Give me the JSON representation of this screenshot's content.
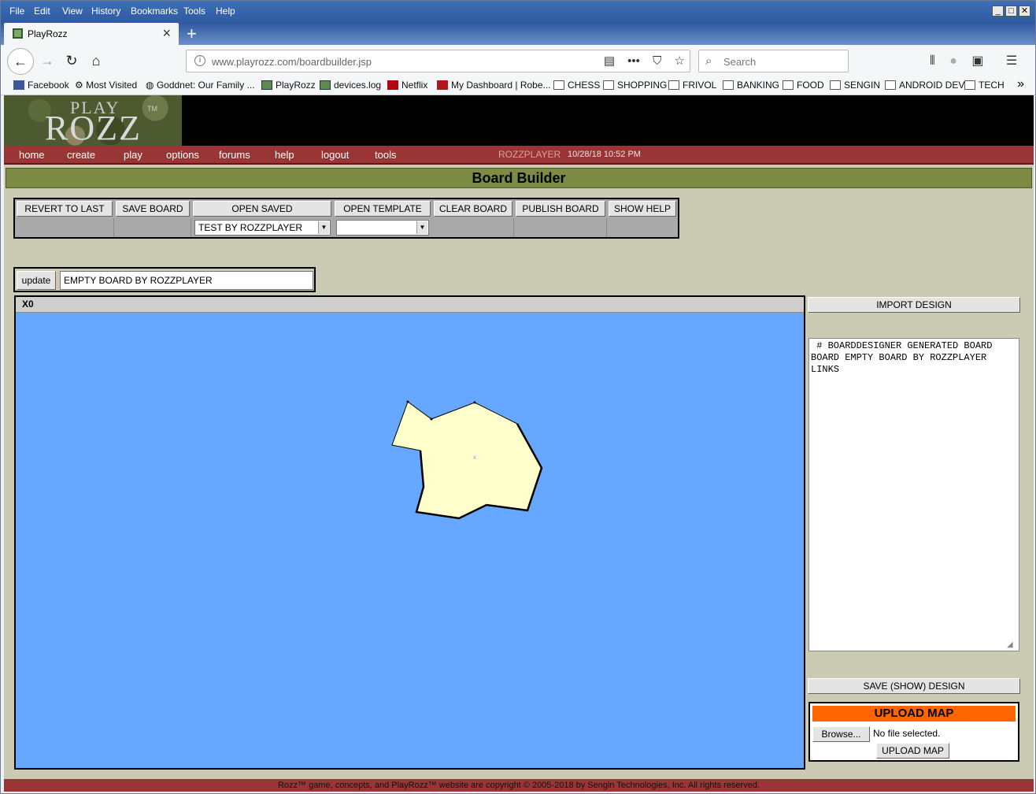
{
  "browser": {
    "menu": [
      "File",
      "Edit",
      "View",
      "History",
      "Bookmarks",
      "Tools",
      "Help"
    ],
    "tab_title": "PlayRozz",
    "url_host": "www.playrozz.com",
    "url_path": "/boardbuilder.jsp",
    "search_placeholder": "Search",
    "bookmarks": [
      "Facebook",
      "Most Visited",
      "Goddnet: Our Family ...",
      "PlayRozz",
      "devices.log",
      "Netflix",
      "My Dashboard | Robe...",
      "CHESS",
      "SHOPPING",
      "FRIVOL",
      "BANKING",
      "FOOD",
      "SENGIN",
      "ANDROID DEV",
      "TECH"
    ]
  },
  "site": {
    "logo_play": "PLAY",
    "logo_rozz": "ROZZ",
    "logo_tm": "TM",
    "nav": [
      "home",
      "create",
      "play",
      "options",
      "forums",
      "help",
      "logout",
      "tools"
    ],
    "user": "ROZZPLAYER",
    "datetime": "10/28/18 10:52 PM",
    "page_title": "Board Builder",
    "footer": "Rozz™ game, concepts, and PlayRozz™ website are copyright © 2005-2018 by Sengin Technologies, Inc. All rights reserved."
  },
  "toolbar": {
    "revert": "REVERT TO LAST",
    "save": "SAVE BOARD",
    "open_saved": "OPEN SAVED",
    "open_template": "OPEN TEMPLATE",
    "clear": "CLEAR BOARD",
    "publish": "PUBLISH BOARD",
    "show_help": "SHOW HELP",
    "saved_selected": "TEST BY ROZZPLAYER",
    "template_selected": ""
  },
  "board": {
    "update_label": "update",
    "name_value": "EMPTY BOARD BY ROZZPLAYER",
    "header": "X0",
    "colors": {
      "water": "#66a8ff",
      "land": "#ffffcc",
      "outline": "#000000"
    }
  },
  "side": {
    "import_label": "IMPORT DESIGN",
    "design_text": " # BOARDDESIGNER GENERATED BOARD\nBOARD EMPTY BOARD BY ROZZPLAYER\nLINKS",
    "save_show_label": "SAVE (SHOW) DESIGN",
    "upload_title": "UPLOAD MAP",
    "browse_label": "Browse...",
    "no_file": "No file selected.",
    "upload_button": "UPLOAD MAP"
  }
}
